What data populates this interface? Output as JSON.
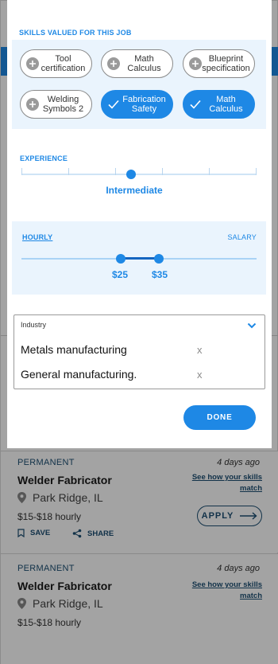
{
  "modal": {
    "skills_heading": "SKILLS VALUED FOR THIS JOB",
    "skills": [
      {
        "label_lines": [
          "Tool",
          "certification"
        ],
        "selected": false
      },
      {
        "label_lines": [
          "Math",
          "Calculus"
        ],
        "selected": false
      },
      {
        "label_lines": [
          "Blueprint",
          "specification"
        ],
        "selected": false
      },
      {
        "label_lines": [
          "Welding",
          "Symbols 2"
        ],
        "selected": false
      },
      {
        "label_lines": [
          "Fabrication",
          "Safety"
        ],
        "selected": true
      },
      {
        "label_lines": [
          "Math",
          "Calculus"
        ],
        "selected": true
      }
    ],
    "experience": {
      "heading": "EXPERIENCE",
      "selected_label": "Intermediate",
      "steps": 5,
      "selected_index": 2
    },
    "pay": {
      "tab_hourly": "HOURLY",
      "tab_salary": "SALARY",
      "active_tab": "HOURLY",
      "min_label": "$25",
      "max_label": "$35"
    },
    "industry": {
      "label": "Industry",
      "items": [
        {
          "name": "Metals manufacturing",
          "remove": "x"
        },
        {
          "name": "General manufacturing.",
          "remove": "x"
        }
      ]
    },
    "done_label": "DONE"
  },
  "jobs": [
    {
      "type": "PERMANENT",
      "posted": "4 days ago",
      "title": "Welder Fabricator",
      "location": "Park Ridge, IL",
      "pay": "$15-$18 hourly",
      "match_line1": "See how your skills",
      "match_line2": "match",
      "apply_label": "APPLY",
      "save_label": "SAVE",
      "share_label": "SHARE"
    },
    {
      "type": "PERMANENT",
      "posted": "4 days ago",
      "title": "Welder Fabricator",
      "location": "Park Ridge, IL",
      "pay": "$15-$18 hourly",
      "match_line1": "See how your skills",
      "match_line2": "match"
    }
  ],
  "colors": {
    "accent": "#1e88e5",
    "accent_light": "#eaf4fd",
    "link_dark": "#1d4f73",
    "overlay": "rgba(0,0,0,0.36)"
  },
  "icons": [
    "plus-circle-icon",
    "checkmark-icon",
    "chevron-down-icon",
    "location-pin-icon",
    "bookmark-icon",
    "share-icon",
    "arrow-right-icon"
  ]
}
